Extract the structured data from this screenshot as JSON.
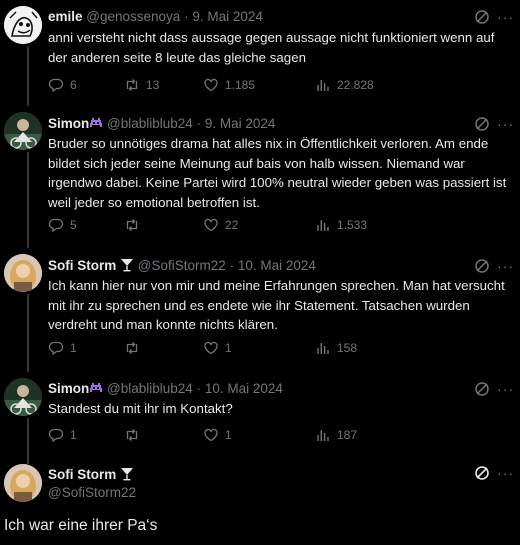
{
  "colors": {
    "background": "#000000",
    "text": "#e7e9ea",
    "muted": "#71767b",
    "thread_line": "#333639"
  },
  "replies": [
    {
      "name": "emile",
      "handle": "@genossenoya",
      "separator": "·",
      "date": "9. Mai 2024",
      "text": "anni versteht nicht dass aussage gegen aussage nicht funktioniert wenn auf der anderen seite 8 leute das gleiche sagen",
      "reply_count": "6",
      "retweet_count": "13",
      "like_count": "1.185",
      "view_count": "22.828",
      "name_emoji": ""
    },
    {
      "name": "Simon",
      "name_emoji": "alien-monster-emoji",
      "handle": "@blabliblub24",
      "separator": "·",
      "date": "9. Mai 2024",
      "text": "Bruder so unnötiges drama hat alles nix in Öffentlichkeit verloren. Am ende bildet sich jeder seine Meinung auf bais von halb wissen. Niemand war irgendwo dabei. Keine Partei wird 100% neutral wieder geben was passiert ist weil jeder so emotional betroffen ist.",
      "reply_count": "5",
      "retweet_count": "",
      "like_count": "22",
      "view_count": "1.533"
    },
    {
      "name": "Sofi Storm",
      "name_emoji": "cocktail-glass-emoji",
      "handle": "@SofiStorm22",
      "separator": "·",
      "date": "10. Mai 2024",
      "text": "Ich kann hier nur von mir und meine Erfahrungen sprechen. Man hat versucht mit ihr zu sprechen und es endete wie ihr Statement. Tatsachen wurden verdreht und man konnte nichts klären.",
      "reply_count": "1",
      "retweet_count": "",
      "like_count": "1",
      "view_count": "158"
    },
    {
      "name": "Simon",
      "name_emoji": "alien-monster-emoji",
      "handle": "@blabliblub24",
      "separator": "·",
      "date": "10. Mai 2024",
      "text": "Standest du mit ihr im Kontakt?",
      "reply_count": "1",
      "retweet_count": "",
      "like_count": "1",
      "view_count": "187"
    }
  ],
  "main_post": {
    "name": "Sofi Storm",
    "name_emoji": "cocktail-glass-emoji",
    "handle": "@SofiStorm22",
    "text": "Ich war eine ihrer Pa‘s"
  },
  "more_glyph": "···"
}
